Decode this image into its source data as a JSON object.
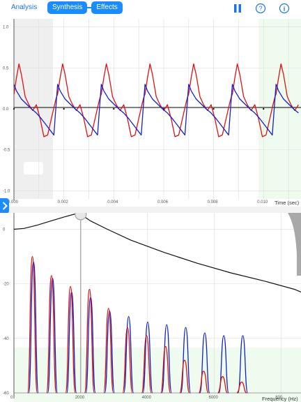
{
  "toolbar": {
    "analysis_label": "Analysis",
    "synthesis_label": "Synthesis",
    "effects_label": "Effects",
    "pause_icon": "pause-icon",
    "help_icon": "help-icon",
    "info_icon": "info-icon",
    "accent_color": "#1a8cff"
  },
  "time_chart": {
    "xlabel": "Time (sec)",
    "x_ticks": [
      "0.000",
      "0.002",
      "0.004",
      "0.006",
      "0.008",
      "0.010"
    ],
    "y_ticks": [
      "1.0",
      "0.5",
      "0.0",
      "-0.5",
      "-1.0"
    ]
  },
  "freq_chart": {
    "xlabel": "Frequency (Hz)",
    "x_ticks": [
      "0",
      "2000",
      "4000",
      "6000",
      "800"
    ],
    "y_ticks": [
      "0",
      "-20",
      "-40",
      "-60"
    ]
  },
  "chart_data": [
    {
      "type": "line",
      "xlabel": "Time (sec)",
      "xlim": [
        0,
        0.0115
      ],
      "ylim": [
        -1.1,
        1.1
      ],
      "grid": true,
      "period": 0.00175,
      "series": [
        {
          "color": "#dd1111",
          "x": [
            0.0,
            0.0001,
            0.0002,
            0.0003,
            0.00045,
            0.0006,
            0.00075,
            0.0009,
            0.00105,
            0.0012,
            0.00135,
            0.0015,
            0.00165,
            0.0017,
            0.00175
          ],
          "values": [
            0.18,
            0.38,
            0.55,
            0.42,
            0.15,
            0.05,
            -0.02,
            0.05,
            -0.12,
            -0.34,
            -0.32,
            -0.12,
            0.08,
            0.14,
            0.18
          ]
        },
        {
          "color": "#1122cc",
          "x": [
            0.0,
            0.0001,
            0.0003,
            0.0005,
            0.0007,
            0.0009,
            0.0011,
            0.0013,
            0.0015,
            0.0016,
            0.0017,
            0.00175
          ],
          "values": [
            0.3,
            0.22,
            0.12,
            0.06,
            0.0,
            -0.05,
            -0.12,
            -0.2,
            -0.28,
            -0.32,
            0.1,
            0.3
          ]
        }
      ]
    },
    {
      "type": "line",
      "xlabel": "Frequency (Hz)",
      "xlim": [
        0,
        8600
      ],
      "ylim": [
        -60,
        6
      ],
      "grid": true,
      "filter_response": {
        "color": "#111111",
        "x": [
          0,
          300,
          700,
          1100,
          1500,
          1800,
          2000,
          2300,
          2800,
          3500,
          4500,
          5500,
          6500,
          7500,
          8400,
          8600
        ],
        "values": [
          0,
          0.3,
          1.5,
          3,
          4.5,
          5.5,
          5.5,
          3,
          0,
          -4,
          -8.5,
          -12.5,
          -16,
          -19,
          -22,
          -23
        ]
      },
      "cutoff_hz": 2000,
      "series": [
        {
          "color": "#1122cc",
          "x": [
            570,
            1140,
            1710,
            2280,
            2850,
            3420,
            3990,
            4560,
            5130,
            5700,
            6270,
            6840
          ],
          "values": [
            -12,
            -18,
            -23,
            -25,
            -30,
            -32,
            -34,
            -35,
            -36,
            -38,
            -39,
            -39
          ]
        },
        {
          "color": "#dd1111",
          "x": [
            570,
            1140,
            1710,
            2280,
            2850,
            3420,
            3990,
            4560,
            5130,
            5700,
            6270,
            6840
          ],
          "values": [
            -10,
            -17,
            -21,
            -22,
            -29,
            -36,
            -39,
            -43,
            -48,
            -52,
            -54,
            -56
          ]
        }
      ]
    }
  ]
}
